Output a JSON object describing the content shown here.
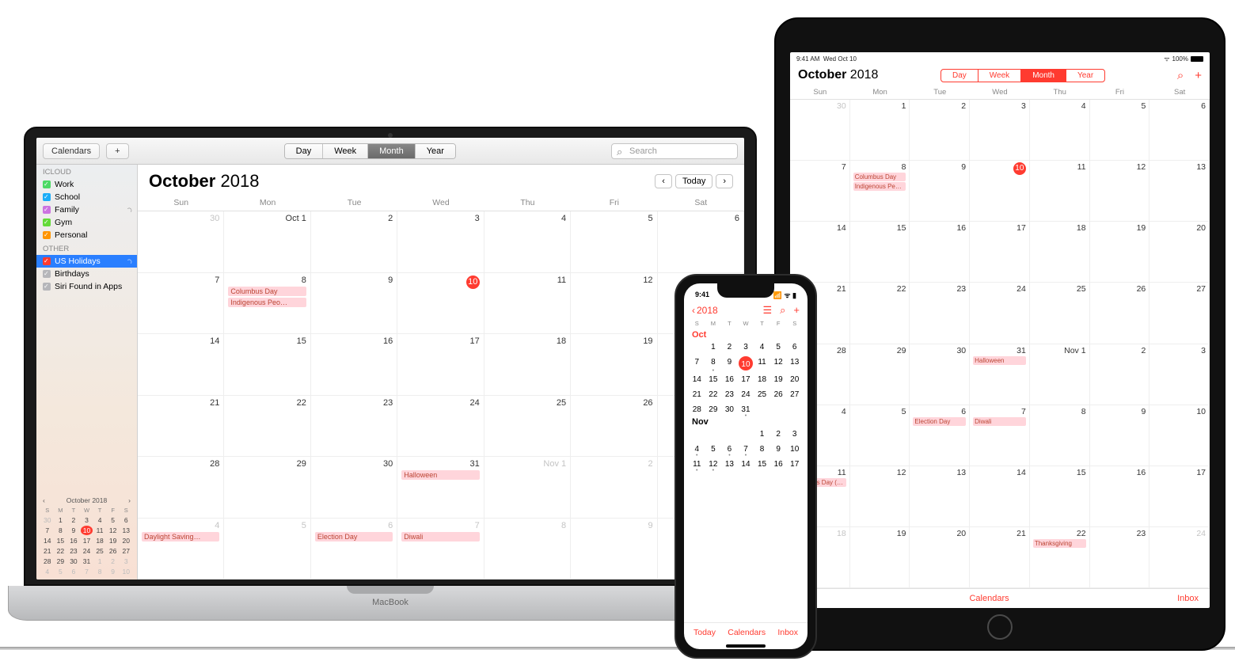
{
  "mac": {
    "toolbar": {
      "calendars": "Calendars",
      "plus": "+",
      "segments": [
        "Day",
        "Week",
        "Month",
        "Year"
      ],
      "active": "Month",
      "search_placeholder": "Search"
    },
    "sidebar": {
      "section1": "iCloud",
      "calendars": [
        {
          "label": "Work",
          "color": "#4cd964"
        },
        {
          "label": "School",
          "color": "#1badf8"
        },
        {
          "label": "Family",
          "color": "#cc73e1"
        },
        {
          "label": "Gym",
          "color": "#63da38"
        },
        {
          "label": "Personal",
          "color": "#ff9500"
        }
      ],
      "section2": "Other",
      "other": [
        {
          "label": "US Holidays",
          "color": "#ff3b30",
          "selected": true
        },
        {
          "label": "Birthdays",
          "color": "#8e8e93"
        },
        {
          "label": "Siri Found in Apps",
          "color": "#8e8e93"
        }
      ],
      "mini": {
        "title": "October 2018"
      }
    },
    "title_month": "October",
    "title_year": "2018",
    "today_btn": "Today",
    "daynames": [
      "Sun",
      "Mon",
      "Tue",
      "Wed",
      "Thu",
      "Fri",
      "Sat"
    ],
    "events": {
      "oct8": [
        "Columbus Day",
        "Indigenous Peo…"
      ],
      "oct31": [
        "Halloween"
      ],
      "nov4": [
        "Daylight Saving…"
      ],
      "nov6": [
        "Election Day"
      ],
      "nov7": [
        "Diwali"
      ]
    },
    "base_label": "MacBook"
  },
  "ipad": {
    "status": {
      "time": "9:41 AM",
      "date": "Wed Oct 10",
      "battery": "100%"
    },
    "title_month": "October",
    "title_year": "2018",
    "segments": [
      "Day",
      "Week",
      "Month",
      "Year"
    ],
    "active": "Month",
    "daynames": [
      "Sun",
      "Mon",
      "Tue",
      "Wed",
      "Thu",
      "Fri",
      "Sat"
    ],
    "events": {
      "oct8": [
        "Columbus Day",
        "Indigenous Peop…"
      ],
      "oct31": [
        "Halloween"
      ],
      "nov6": [
        "Election Day"
      ],
      "nov7": [
        "Diwali"
      ],
      "nov11": [
        "Veterans Day (o…"
      ],
      "nov22": [
        "Thanksgiving"
      ]
    },
    "foot": {
      "calendars": "Calendars",
      "inbox": "Inbox"
    }
  },
  "iphone": {
    "time": "9:41",
    "back": "2018",
    "dayletters": [
      "S",
      "M",
      "T",
      "W",
      "T",
      "F",
      "S"
    ],
    "month1": "Oct",
    "month2": "Nov",
    "foot": {
      "today": "Today",
      "calendars": "Calendars",
      "inbox": "Inbox"
    }
  }
}
